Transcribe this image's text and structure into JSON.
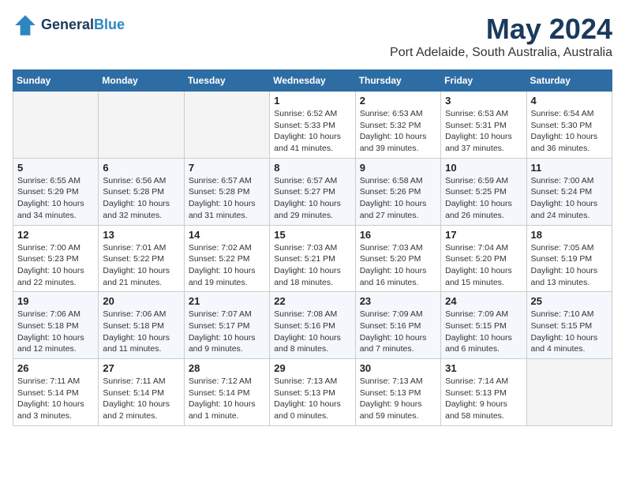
{
  "header": {
    "logo_line1": "General",
    "logo_line2": "Blue",
    "month": "May 2024",
    "location": "Port Adelaide, South Australia, Australia"
  },
  "days_of_week": [
    "Sunday",
    "Monday",
    "Tuesday",
    "Wednesday",
    "Thursday",
    "Friday",
    "Saturday"
  ],
  "weeks": [
    [
      {
        "day": "",
        "info": ""
      },
      {
        "day": "",
        "info": ""
      },
      {
        "day": "",
        "info": ""
      },
      {
        "day": "1",
        "info": "Sunrise: 6:52 AM\nSunset: 5:33 PM\nDaylight: 10 hours\nand 41 minutes."
      },
      {
        "day": "2",
        "info": "Sunrise: 6:53 AM\nSunset: 5:32 PM\nDaylight: 10 hours\nand 39 minutes."
      },
      {
        "day": "3",
        "info": "Sunrise: 6:53 AM\nSunset: 5:31 PM\nDaylight: 10 hours\nand 37 minutes."
      },
      {
        "day": "4",
        "info": "Sunrise: 6:54 AM\nSunset: 5:30 PM\nDaylight: 10 hours\nand 36 minutes."
      }
    ],
    [
      {
        "day": "5",
        "info": "Sunrise: 6:55 AM\nSunset: 5:29 PM\nDaylight: 10 hours\nand 34 minutes."
      },
      {
        "day": "6",
        "info": "Sunrise: 6:56 AM\nSunset: 5:28 PM\nDaylight: 10 hours\nand 32 minutes."
      },
      {
        "day": "7",
        "info": "Sunrise: 6:57 AM\nSunset: 5:28 PM\nDaylight: 10 hours\nand 31 minutes."
      },
      {
        "day": "8",
        "info": "Sunrise: 6:57 AM\nSunset: 5:27 PM\nDaylight: 10 hours\nand 29 minutes."
      },
      {
        "day": "9",
        "info": "Sunrise: 6:58 AM\nSunset: 5:26 PM\nDaylight: 10 hours\nand 27 minutes."
      },
      {
        "day": "10",
        "info": "Sunrise: 6:59 AM\nSunset: 5:25 PM\nDaylight: 10 hours\nand 26 minutes."
      },
      {
        "day": "11",
        "info": "Sunrise: 7:00 AM\nSunset: 5:24 PM\nDaylight: 10 hours\nand 24 minutes."
      }
    ],
    [
      {
        "day": "12",
        "info": "Sunrise: 7:00 AM\nSunset: 5:23 PM\nDaylight: 10 hours\nand 22 minutes."
      },
      {
        "day": "13",
        "info": "Sunrise: 7:01 AM\nSunset: 5:22 PM\nDaylight: 10 hours\nand 21 minutes."
      },
      {
        "day": "14",
        "info": "Sunrise: 7:02 AM\nSunset: 5:22 PM\nDaylight: 10 hours\nand 19 minutes."
      },
      {
        "day": "15",
        "info": "Sunrise: 7:03 AM\nSunset: 5:21 PM\nDaylight: 10 hours\nand 18 minutes."
      },
      {
        "day": "16",
        "info": "Sunrise: 7:03 AM\nSunset: 5:20 PM\nDaylight: 10 hours\nand 16 minutes."
      },
      {
        "day": "17",
        "info": "Sunrise: 7:04 AM\nSunset: 5:20 PM\nDaylight: 10 hours\nand 15 minutes."
      },
      {
        "day": "18",
        "info": "Sunrise: 7:05 AM\nSunset: 5:19 PM\nDaylight: 10 hours\nand 13 minutes."
      }
    ],
    [
      {
        "day": "19",
        "info": "Sunrise: 7:06 AM\nSunset: 5:18 PM\nDaylight: 10 hours\nand 12 minutes."
      },
      {
        "day": "20",
        "info": "Sunrise: 7:06 AM\nSunset: 5:18 PM\nDaylight: 10 hours\nand 11 minutes."
      },
      {
        "day": "21",
        "info": "Sunrise: 7:07 AM\nSunset: 5:17 PM\nDaylight: 10 hours\nand 9 minutes."
      },
      {
        "day": "22",
        "info": "Sunrise: 7:08 AM\nSunset: 5:16 PM\nDaylight: 10 hours\nand 8 minutes."
      },
      {
        "day": "23",
        "info": "Sunrise: 7:09 AM\nSunset: 5:16 PM\nDaylight: 10 hours\nand 7 minutes."
      },
      {
        "day": "24",
        "info": "Sunrise: 7:09 AM\nSunset: 5:15 PM\nDaylight: 10 hours\nand 6 minutes."
      },
      {
        "day": "25",
        "info": "Sunrise: 7:10 AM\nSunset: 5:15 PM\nDaylight: 10 hours\nand 4 minutes."
      }
    ],
    [
      {
        "day": "26",
        "info": "Sunrise: 7:11 AM\nSunset: 5:14 PM\nDaylight: 10 hours\nand 3 minutes."
      },
      {
        "day": "27",
        "info": "Sunrise: 7:11 AM\nSunset: 5:14 PM\nDaylight: 10 hours\nand 2 minutes."
      },
      {
        "day": "28",
        "info": "Sunrise: 7:12 AM\nSunset: 5:14 PM\nDaylight: 10 hours\nand 1 minute."
      },
      {
        "day": "29",
        "info": "Sunrise: 7:13 AM\nSunset: 5:13 PM\nDaylight: 10 hours\nand 0 minutes."
      },
      {
        "day": "30",
        "info": "Sunrise: 7:13 AM\nSunset: 5:13 PM\nDaylight: 9 hours\nand 59 minutes."
      },
      {
        "day": "31",
        "info": "Sunrise: 7:14 AM\nSunset: 5:13 PM\nDaylight: 9 hours\nand 58 minutes."
      },
      {
        "day": "",
        "info": ""
      }
    ]
  ]
}
